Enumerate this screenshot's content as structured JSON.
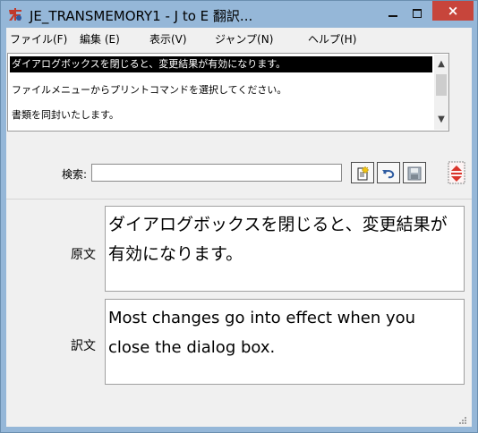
{
  "window": {
    "title": "JE_TRANSMEMORY1 - J to E 翻訳...",
    "close_label": "×"
  },
  "menu": [
    {
      "label": "ファイル(F)"
    },
    {
      "label": "編集 (E)"
    },
    {
      "label": "表示(V)"
    },
    {
      "label": "ジャンプ(N)"
    },
    {
      "label": "ヘルプ(H)"
    }
  ],
  "list": {
    "items": [
      {
        "text": "ダイアログボックスを閉じると、変更結果が有効になります。",
        "selected": true
      },
      {
        "text": "ファイルメニューからプリントコマンドを選択してください。",
        "selected": false
      },
      {
        "text": "書類を同封いたします。",
        "selected": false
      }
    ]
  },
  "search": {
    "label": "検索:",
    "value": ""
  },
  "source": {
    "label": "原文",
    "text": "ダイアログボックスを閉じると、変更結果が有効になります。"
  },
  "translation": {
    "label": "訳文",
    "text": "Most changes go into effect when you close the dialog box."
  },
  "colors": {
    "titlebar": "#95b7d8",
    "close": "#c7453b",
    "selection": "#000000"
  }
}
